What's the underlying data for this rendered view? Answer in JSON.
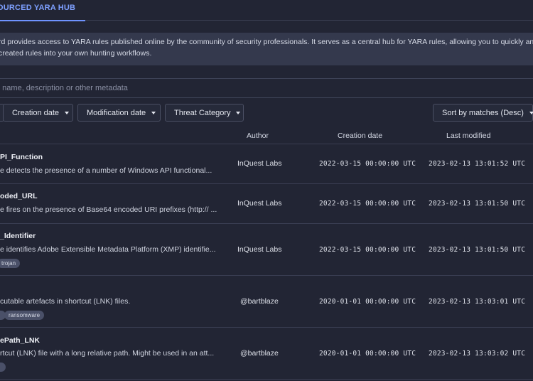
{
  "tab": {
    "label": "OURCED YARA HUB"
  },
  "notice": {
    "line1": "rd provides access to YARA rules published online by the community of security professionals. It serves as a central hub for YARA rules, allowing you to quickly and easily",
    "line2": "created rules into your own hunting workflows."
  },
  "search": {
    "placeholder": "e name, description or other metadata"
  },
  "filters": {
    "creation_date": "Creation date",
    "modification_date": "Modification date",
    "threat_category": "Threat Category",
    "sort": "Sort by matches (Desc)"
  },
  "table": {
    "headers": {
      "author": "Author",
      "creation": "Creation date",
      "modified": "Last modified"
    },
    "rows": [
      {
        "name": "PI_Function",
        "desc": "e detects the presence of a number of Windows API functional...",
        "author": "InQuest Labs",
        "created": "2022-03-15 00:00:00 UTC",
        "modified": "2023-02-13 13:01:52 UTC",
        "tags": []
      },
      {
        "name": "oded_URL",
        "desc": "e fires on the presence of Base64 encoded URI prefixes (http:// ...",
        "author": "InQuest Labs",
        "created": "2022-03-15 00:00:00 UTC",
        "modified": "2023-02-13 13:01:50 UTC",
        "tags": []
      },
      {
        "name": "_Identifier",
        "desc": "e identifies Adobe Extensible Metadata Platform (XMP) identifie...",
        "author": "InQuest Labs",
        "created": "2022-03-15 00:00:00 UTC",
        "modified": "2023-02-13 13:01:50 UTC",
        "tags": [
          "trojan"
        ]
      },
      {
        "name": "",
        "desc": "cutable artefacts in shortcut (LNK) files.",
        "author": "@bartblaze",
        "created": "2020-01-01 00:00:00 UTC",
        "modified": "2023-02-13 13:03:01 UTC",
        "tags": [
          "",
          "ransomware"
        ]
      },
      {
        "name": "ePath_LNK",
        "desc": "rtcut (LNK) file with a long relative path. Might be used in an att...",
        "author": "@bartblaze",
        "created": "2020-01-01 00:00:00 UTC",
        "modified": "2023-02-13 13:03:02 UTC",
        "tags": [
          ""
        ]
      }
    ]
  }
}
